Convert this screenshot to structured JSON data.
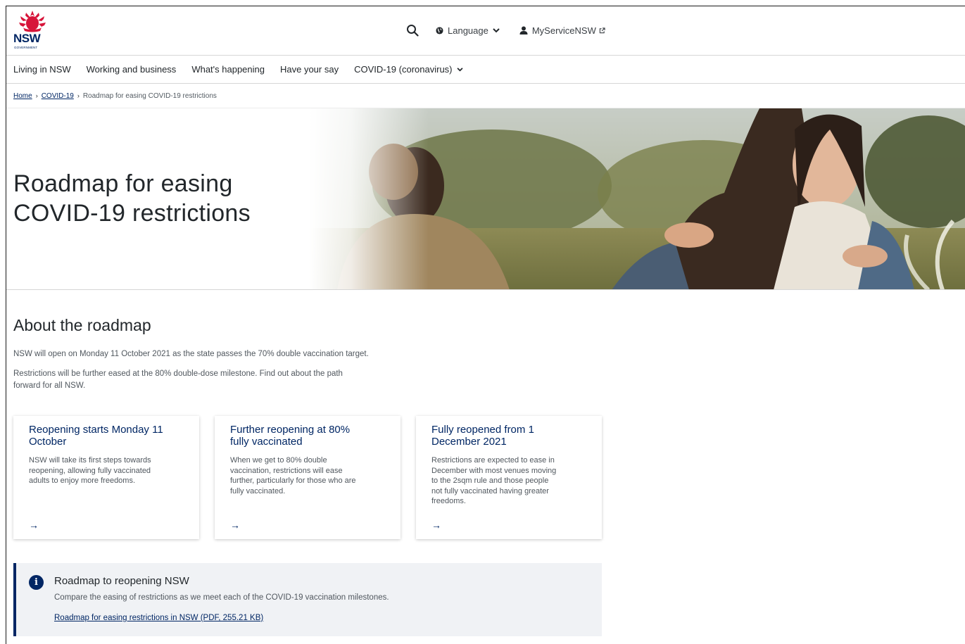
{
  "header": {
    "logo_text": "NSW",
    "logo_sub": "GOVERNMENT",
    "language_label": "Language",
    "account_label": "MyServiceNSW"
  },
  "nav": {
    "items": [
      {
        "label": "Living in NSW"
      },
      {
        "label": "Working and business"
      },
      {
        "label": "What's happening"
      },
      {
        "label": "Have your say"
      },
      {
        "label": "COVID-19 (coronavirus)"
      }
    ]
  },
  "breadcrumb": {
    "home": "Home",
    "covid": "COVID-19",
    "current": "Roadmap for easing COVID-19 restrictions",
    "separator": "›"
  },
  "hero": {
    "title_line1": "Roadmap for easing",
    "title_line2": "COVID-19 restrictions"
  },
  "about": {
    "heading": "About the roadmap",
    "para1": "NSW will open on Monday 11 October 2021 as the state passes the 70% double vaccination target.",
    "para2_line1": "Restrictions will be further eased at the 80% double-dose milestone. Find out about the path",
    "para2_line2": "forward for all NSW."
  },
  "cards": [
    {
      "title_line1": "Reopening starts Monday 11",
      "title_line2": "October",
      "body": [
        "NSW will take its first steps towards",
        "reopening, allowing fully vaccinated",
        "adults to enjoy more freedoms."
      ],
      "arrow": "→"
    },
    {
      "title_line1": "Further reopening at 80%",
      "title_line2": "fully vaccinated",
      "body": [
        "When we get to 80% double",
        "vaccination, restrictions will ease",
        "further, particularly for those who are",
        "fully vaccinated."
      ],
      "arrow": "→"
    },
    {
      "title_line1": "Fully reopened from 1",
      "title_line2": "December 2021",
      "body": [
        "Restrictions are expected to ease in",
        "December with most venues moving",
        "to the 2sqm rule and those people",
        "not fully vaccinated having greater",
        "freedoms."
      ],
      "arrow": "→"
    }
  ],
  "callout": {
    "icon": "i",
    "title": "Roadmap to reopening NSW",
    "text": "Compare the easing of restrictions as we meet each of the COVID-19 vaccination milestones.",
    "link": "Roadmap for easing restrictions in NSW (PDF, 255.21 KB)"
  },
  "colors": {
    "brand_navy": "#002664",
    "brand_red": "#d7153a",
    "callout_bg": "#f0f2f5"
  }
}
